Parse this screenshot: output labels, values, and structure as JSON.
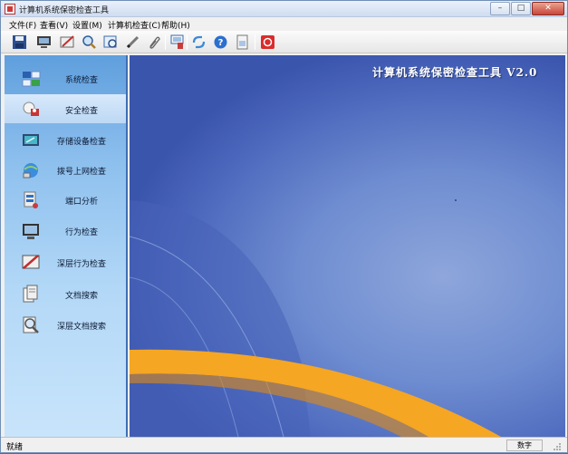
{
  "window": {
    "title": "计算机系统保密检查工具"
  },
  "menu": [
    "文件(F)",
    "查看(V)",
    "设置(M)",
    "计算机检查(C)",
    "帮助(H)"
  ],
  "toolbar": {
    "icons": [
      "save-icon",
      "monitor-icon",
      "edit-icon",
      "zoom-icon",
      "view-icon",
      "pen-icon",
      "paperclip-icon",
      "print-icon",
      "refresh-icon",
      "help-icon",
      "document-icon",
      "stop-icon"
    ]
  },
  "sidebar": {
    "items": [
      {
        "label": "系统检查",
        "icon": "system-check-icon"
      },
      {
        "label": "安全检查",
        "icon": "security-check-icon"
      },
      {
        "label": "存储设备检查",
        "icon": "storage-device-icon"
      },
      {
        "label": "拨号上网检查",
        "icon": "dialup-network-icon"
      },
      {
        "label": "端口分析",
        "icon": "port-analysis-icon"
      },
      {
        "label": "行为检查",
        "icon": "behavior-check-icon"
      },
      {
        "label": "深层行为检查",
        "icon": "deep-behavior-icon"
      },
      {
        "label": "文档搜索",
        "icon": "document-search-icon"
      },
      {
        "label": "深层文档搜索",
        "icon": "deep-document-search-icon"
      }
    ],
    "selected_index": 1
  },
  "main": {
    "brand_title": "计算机系统保密检查工具  V2.0"
  },
  "status": {
    "text": "就绪",
    "num_label": "数字"
  },
  "colors": {
    "accent": "#3f6fb4",
    "banner": "#f5a623",
    "sidebar_top": "#5f9fdd"
  }
}
